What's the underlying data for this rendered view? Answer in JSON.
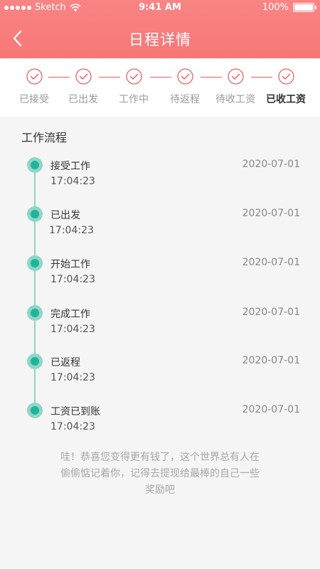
{
  "status_bar": {
    "carrier": "Sketch",
    "time": "9:41 AM",
    "battery": "100%"
  },
  "header": {
    "title": "日程详情",
    "back_icon": "chevron-left-icon"
  },
  "steps": [
    {
      "label": "已接受",
      "icon": "check-circle-icon",
      "active": false
    },
    {
      "label": "已出发",
      "icon": "check-circle-icon",
      "active": false
    },
    {
      "label": "工作中",
      "icon": "check-circle-icon",
      "active": false
    },
    {
      "label": "待返程",
      "icon": "check-circle-icon",
      "active": false
    },
    {
      "label": "待收工资",
      "icon": "check-circle-icon",
      "active": false
    },
    {
      "label": "已收工资",
      "icon": "check-circle-icon",
      "active": true
    }
  ],
  "workflow": {
    "title": "工作流程",
    "events": [
      {
        "name": "接受工作",
        "date": "2020-07-01",
        "time": "17:04:23"
      },
      {
        "name": "已出发",
        "date": "2020-07-01",
        "time": "17:04:23"
      },
      {
        "name": "开始工作",
        "date": "2020-07-01",
        "time": "17:04:23"
      },
      {
        "name": "完成工作",
        "date": "2020-07-01",
        "time": "17:04:23"
      },
      {
        "name": "已返程",
        "date": "2020-07-01",
        "time": "17:04:23"
      },
      {
        "name": "工资已到账",
        "date": "2020-07-01",
        "time": "17:04:23"
      }
    ]
  },
  "message": {
    "line1": "哇！恭喜您变得更有钱了，这个世界总有人在",
    "line2": "偷偷惦记着你，记得去提现给最棒的自己一些",
    "line3": "奖励吧"
  },
  "colors": {
    "header": "#f77777",
    "step_accent": "#e85a5a",
    "timeline": "#8fd6c8",
    "timeline_dot": "#1fb59a"
  }
}
